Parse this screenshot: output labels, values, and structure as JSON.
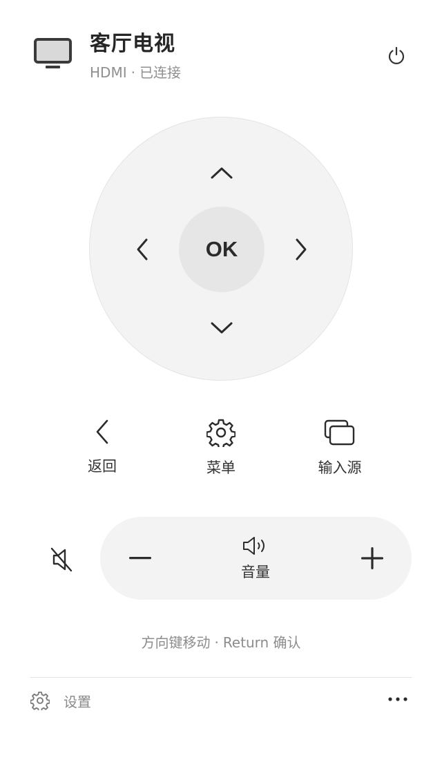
{
  "device": {
    "name": "客厅电视",
    "input": "HDMI",
    "separator": "·",
    "status": "已连接",
    "icon": "tv-icon"
  },
  "header": {
    "power_icon": "power-icon"
  },
  "dpad": {
    "ok_label": "OK",
    "up_icon": "chevron-up-icon",
    "down_icon": "chevron-down-icon",
    "left_icon": "chevron-left-icon",
    "right_icon": "chevron-right-icon"
  },
  "actions": [
    {
      "label": "返回",
      "icon": "back-icon"
    },
    {
      "label": "菜单",
      "icon": "gear-icon"
    },
    {
      "label": "输入源",
      "icon": "input-source-icon"
    }
  ],
  "volume": {
    "label": "音量",
    "minus_icon": "minus-icon",
    "plus_icon": "plus-icon",
    "speaker_icon": "speaker-icon",
    "mute_icon": "mute-icon"
  },
  "hint": {
    "left": "方向键移动",
    "separator": "·",
    "right": "Return 确认"
  },
  "footer": {
    "settings_label": "设置",
    "settings_icon": "gear-icon",
    "more_icon": "more-icon"
  },
  "colors": {
    "background": "#ffffff",
    "surface": "#f3f3f3",
    "ok_button": "#e6e6e6",
    "text": "#2b2b2b",
    "muted_text": "#8f8f8f"
  }
}
